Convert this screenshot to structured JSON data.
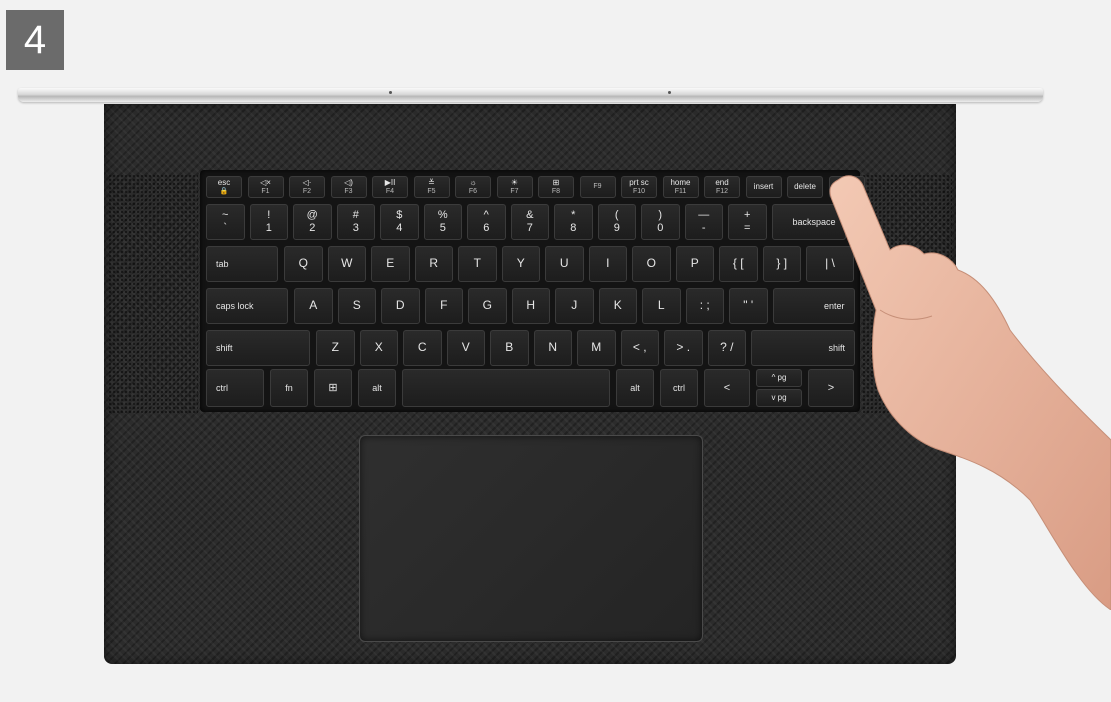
{
  "step_number": "4",
  "colors": {
    "badge": "#6b6b6b",
    "deck": "#2c2c2c",
    "key": "#1d1d1d",
    "skin": "#e9b9a2"
  },
  "keyboard": {
    "row_function": [
      {
        "main": "esc",
        "sub": "🔒"
      },
      {
        "main": "◁×",
        "sub": "F1"
      },
      {
        "main": "◁·",
        "sub": "F2"
      },
      {
        "main": "◁)",
        "sub": "F3"
      },
      {
        "main": "▶II",
        "sub": "F4"
      },
      {
        "main": "≚",
        "sub": "F5"
      },
      {
        "main": "☼",
        "sub": "F6"
      },
      {
        "main": "☀",
        "sub": "F7"
      },
      {
        "main": "⊞",
        "sub": "F8"
      },
      {
        "main": "",
        "sub": "F9"
      },
      {
        "main": "prt sc",
        "sub": "F10"
      },
      {
        "main": "home",
        "sub": "F11"
      },
      {
        "main": "end",
        "sub": "F12"
      },
      {
        "main": "insert",
        "sub": ""
      },
      {
        "main": "delete",
        "sub": ""
      },
      {
        "main": "",
        "sub": ""
      }
    ],
    "row_number": [
      {
        "top": "~",
        "bottom": "`"
      },
      {
        "top": "!",
        "bottom": "1"
      },
      {
        "top": "@",
        "bottom": "2"
      },
      {
        "top": "#",
        "bottom": "3"
      },
      {
        "top": "$",
        "bottom": "4"
      },
      {
        "top": "%",
        "bottom": "5"
      },
      {
        "top": "^",
        "bottom": "6"
      },
      {
        "top": "&",
        "bottom": "7"
      },
      {
        "top": "*",
        "bottom": "8"
      },
      {
        "top": "(",
        "bottom": "9"
      },
      {
        "top": ")",
        "bottom": "0"
      },
      {
        "top": "—",
        "bottom": "-"
      },
      {
        "top": "+",
        "bottom": "="
      },
      {
        "top": "backspace",
        "bottom": ""
      }
    ],
    "row_qwerty": [
      "tab",
      "Q",
      "W",
      "E",
      "R",
      "T",
      "Y",
      "U",
      "I",
      "O",
      "P",
      "{ [",
      "} ]",
      "| \\"
    ],
    "row_home": [
      "caps lock",
      "A",
      "S",
      "D",
      "F",
      "G",
      "H",
      "J",
      "K",
      "L",
      ": ;",
      "\" '",
      "enter"
    ],
    "row_shift": [
      "shift",
      "Z",
      "X",
      "C",
      "V",
      "B",
      "N",
      "M",
      "< ,",
      "> .",
      "? /",
      "shift"
    ],
    "row_bottom": {
      "ctrl": "ctrl",
      "fn": "fn",
      "win": "⊞",
      "alt": "alt",
      "space": "",
      "alt_r": "alt",
      "ctrl_r": "ctrl",
      "left": "<",
      "up": "^ pg",
      "down": "v pg",
      "right": ">"
    }
  }
}
